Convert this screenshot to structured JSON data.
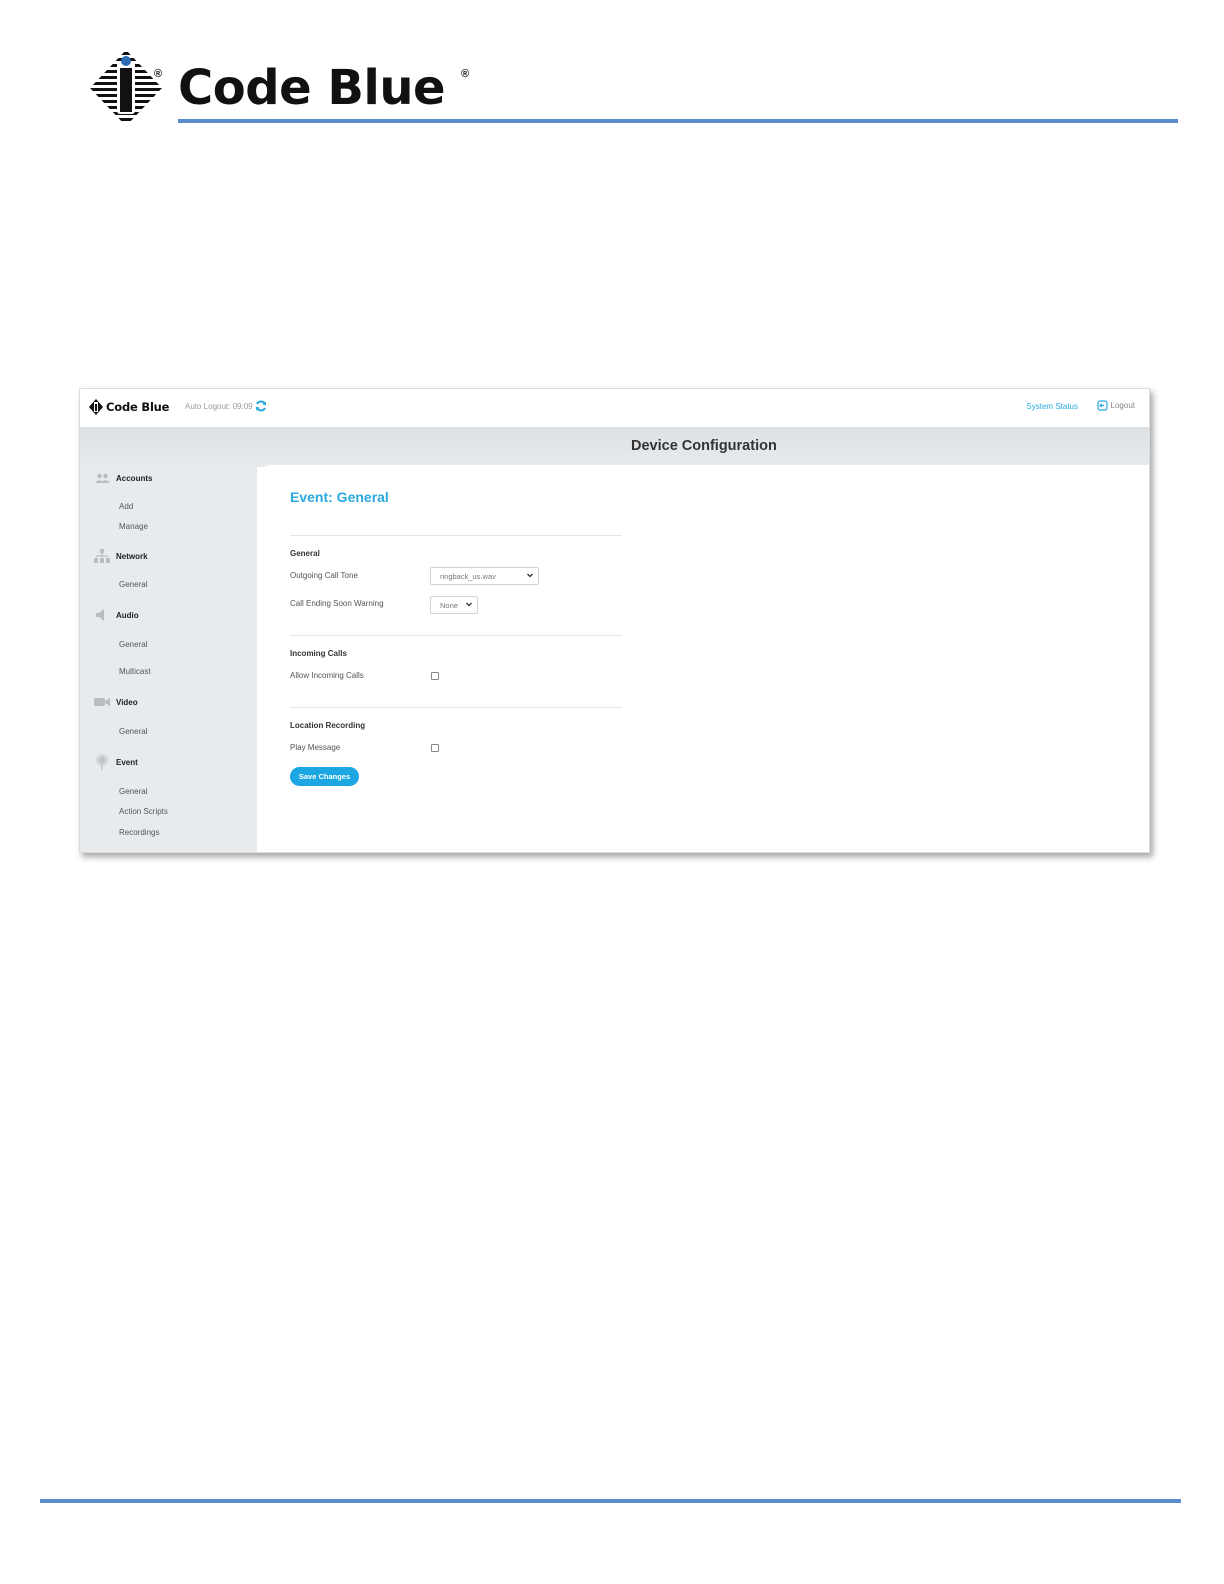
{
  "document": {
    "brand": "Code Blue",
    "accent_color": "#5b8ccc"
  },
  "app": {
    "brand": "Code Blue",
    "auto_logout": "Auto Logout: 09:09",
    "system_status": "System Status",
    "logout": "Logout",
    "page_title": "Device Configuration"
  },
  "sidebar": {
    "sections": [
      {
        "label": "Accounts",
        "icon": "users-icon",
        "items": [
          "Add",
          "Manage"
        ]
      },
      {
        "label": "Network",
        "icon": "network-icon",
        "items": [
          "General"
        ]
      },
      {
        "label": "Audio",
        "icon": "speaker-icon",
        "items": [
          "General",
          "Multicast"
        ]
      },
      {
        "label": "Video",
        "icon": "camera-icon",
        "items": [
          "General"
        ]
      },
      {
        "label": "Event",
        "icon": "pin-icon",
        "items": [
          "General",
          "Action Scripts",
          "Recordings"
        ]
      }
    ]
  },
  "main": {
    "title": "Event: General",
    "general": {
      "heading": "General",
      "outgoing_label": "Outgoing Call Tone",
      "outgoing_value": "ringback_us.wav",
      "warning_label": "Call Ending Soon Warning",
      "warning_value": "None"
    },
    "incoming": {
      "heading": "Incoming Calls",
      "allow_label": "Allow Incoming Calls",
      "allow_checked": false
    },
    "location": {
      "heading": "Location Recording",
      "play_label": "Play Message",
      "play_checked": false
    },
    "save_label": "Save Changes",
    "accent_color": "#29a9e0"
  }
}
